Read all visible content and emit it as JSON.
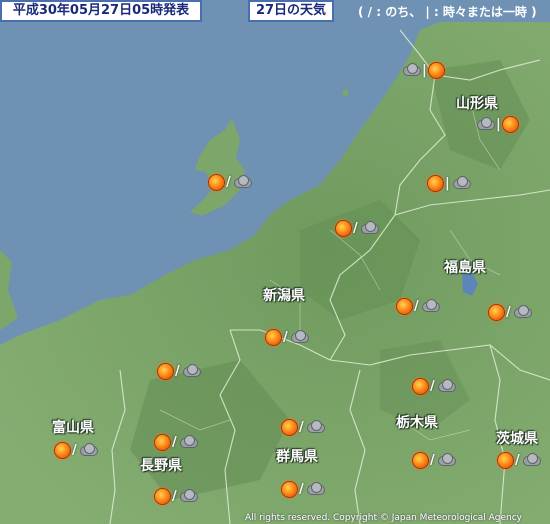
{
  "header": {
    "issue_datetime": "平成30年05月27日05時発表",
    "forecast_day": "27日の天気",
    "legend": "( / : のち、 | : 時々または一時 )"
  },
  "prefectures": {
    "yamagata": "山形県",
    "fukushima": "福島県",
    "niigata": "新潟県",
    "toyama": "富山県",
    "nagano": "長野県",
    "gunma": "群馬県",
    "tochigi": "栃木県",
    "ibaraki": "茨城県"
  },
  "forecasts": [
    {
      "id": "yamagata-north",
      "first": "cloud",
      "sep": "|",
      "second": "sun"
    },
    {
      "id": "yamagata-east",
      "first": "cloud",
      "sep": "|",
      "second": "sun"
    },
    {
      "id": "yamagata-south",
      "first": "sun",
      "sep": "|",
      "second": "cloud"
    },
    {
      "id": "sado",
      "first": "sun",
      "sep": "/",
      "second": "cloud"
    },
    {
      "id": "niigata-kaetsu",
      "first": "sun",
      "sep": "/",
      "second": "cloud"
    },
    {
      "id": "fukushima-aizu",
      "first": "sun",
      "sep": "/",
      "second": "cloud"
    },
    {
      "id": "fukushima-hamadori",
      "first": "sun",
      "sep": "/",
      "second": "cloud"
    },
    {
      "id": "niigata-chuetsu",
      "first": "sun",
      "sep": "/",
      "second": "cloud"
    },
    {
      "id": "niigata-joetsu",
      "first": "sun",
      "sep": "/",
      "second": "cloud"
    },
    {
      "id": "tochigi-north",
      "first": "sun",
      "sep": "/",
      "second": "cloud"
    },
    {
      "id": "toyama",
      "first": "sun",
      "sep": "/",
      "second": "cloud"
    },
    {
      "id": "nagano-north",
      "first": "sun",
      "sep": "/",
      "second": "cloud"
    },
    {
      "id": "gunma-north",
      "first": "sun",
      "sep": "/",
      "second": "cloud"
    },
    {
      "id": "tochigi-south",
      "first": "sun",
      "sep": "/",
      "second": "cloud"
    },
    {
      "id": "ibaraki",
      "first": "sun",
      "sep": "/",
      "second": "cloud"
    },
    {
      "id": "nagano-center",
      "first": "sun",
      "sep": "/",
      "second": "cloud"
    },
    {
      "id": "gunma-south",
      "first": "sun",
      "sep": "/",
      "second": "cloud"
    }
  ],
  "copyright": "All rights reserved. Copyright © Japan Meteorological Agency",
  "colors": {
    "sea": "#6f92b4",
    "land": "#7da66a",
    "mountain": "#5f8a52",
    "boundary": "#d8e8c8"
  }
}
